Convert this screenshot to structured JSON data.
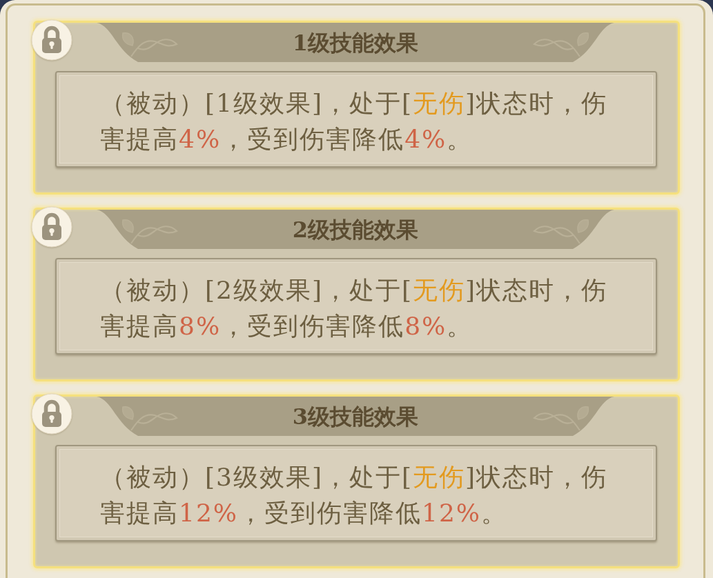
{
  "cards": [
    {
      "title": "1级技能效果",
      "locked": true,
      "description": [
        {
          "kind": "plain",
          "text": "（被动）[1级效果]，处于["
        },
        {
          "kind": "status",
          "text": "无伤"
        },
        {
          "kind": "plain",
          "text": "]状态时，伤害提高"
        },
        {
          "kind": "value",
          "text": "4%"
        },
        {
          "kind": "plain",
          "text": "，受到伤害降低"
        },
        {
          "kind": "value",
          "text": "4%"
        },
        {
          "kind": "plain",
          "text": "。"
        }
      ]
    },
    {
      "title": "2级技能效果",
      "locked": true,
      "description": [
        {
          "kind": "plain",
          "text": "（被动）[2级效果]，处于["
        },
        {
          "kind": "status",
          "text": "无伤"
        },
        {
          "kind": "plain",
          "text": "]状态时，伤害提高"
        },
        {
          "kind": "value",
          "text": "8%"
        },
        {
          "kind": "plain",
          "text": "，受到伤害降低"
        },
        {
          "kind": "value",
          "text": "8%"
        },
        {
          "kind": "plain",
          "text": "。"
        }
      ]
    },
    {
      "title": "3级技能效果",
      "locked": true,
      "description": [
        {
          "kind": "plain",
          "text": "（被动）[3级效果]，处于["
        },
        {
          "kind": "status",
          "text": "无伤"
        },
        {
          "kind": "plain",
          "text": "]状态时，伤害提高"
        },
        {
          "kind": "value",
          "text": "12%"
        },
        {
          "kind": "plain",
          "text": "，受到伤害降低"
        },
        {
          "kind": "value",
          "text": "12%"
        },
        {
          "kind": "plain",
          "text": "。"
        }
      ]
    }
  ]
}
